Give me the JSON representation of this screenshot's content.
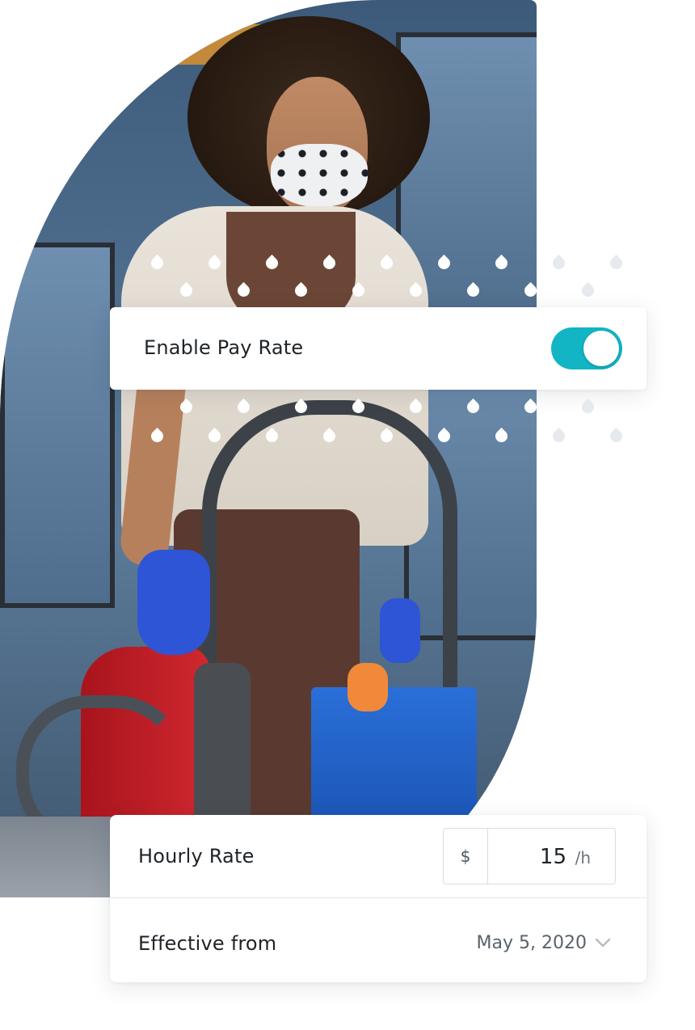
{
  "pay_rate": {
    "label": "Enable Pay Rate",
    "enabled": true,
    "toggle_color": "#11b5c4"
  },
  "hourly_rate": {
    "label": "Hourly Rate",
    "currency_symbol": "$",
    "value": "15",
    "unit": "/h"
  },
  "effective_from": {
    "label": "Effective from",
    "date": "May 5, 2020",
    "icon": "chevron-down-icon"
  }
}
